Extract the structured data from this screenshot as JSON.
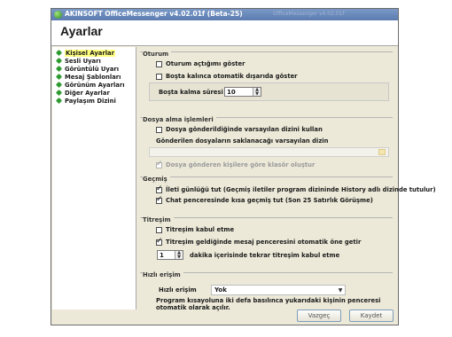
{
  "window": {
    "title": "AKINSOFT OfficeMessenger v4.02.01f (Beta-25)",
    "title_faded": "OfficeMessenger v4.02.01f"
  },
  "header": {
    "title": "Ayarlar"
  },
  "sidebar": {
    "items": [
      {
        "label": "Kişisel Ayarlar",
        "selected": true
      },
      {
        "label": "Sesli Uyarı"
      },
      {
        "label": "Görüntülü Uyarı"
      },
      {
        "label": "Mesaj Şablonları"
      },
      {
        "label": "Görünüm Ayarları"
      },
      {
        "label": "Diğer Ayarlar"
      },
      {
        "label": "Paylaşım Dizini"
      }
    ]
  },
  "oturum": {
    "title": "Oturum",
    "cb1": "Oturum açtığımı göster",
    "cb2": "Boşta kalınca otomatik dışarıda göster",
    "idle_label": "Boşta kalma süresi",
    "idle_value": "10"
  },
  "dosya": {
    "title": "Dosya alma işlemleri",
    "cb1": "Dosya gönderildiğinde varsayılan dizini kullan",
    "dir_label": "Gönderilen dosyaların saklanacağı varsayılan dizin",
    "dir_value": "",
    "cb2": "Dosya gönderen kişilere göre klasör oluştur"
  },
  "gecmis": {
    "title": "Geçmiş",
    "cb1": "İleti günlüğü tut (Geçmiş iletiler program dizininde History adlı dizinde tutulur)",
    "cb2": "Chat penceresinde kısa geçmiş tut (Son 25 Satırlık Görüşme)"
  },
  "titresim": {
    "title": "Titreşim",
    "cb1": "Titreşim kabul etme",
    "cb2": "Titreşim geldiğinde mesaj penceresini otomatik öne getir",
    "minutes_value": "1",
    "minutes_label": "dakika içerisinde tekrar titreşim kabul etme"
  },
  "hizli": {
    "title": "Hızlı erişim",
    "label": "Hızlı erişim",
    "value": "Yok",
    "desc": "Program kısayoluna iki defa basılınca yukarıdaki kişinin penceresi otomatik olarak açılır."
  },
  "buttons": {
    "cancel": "Vazgeç",
    "save": "Kaydet"
  }
}
